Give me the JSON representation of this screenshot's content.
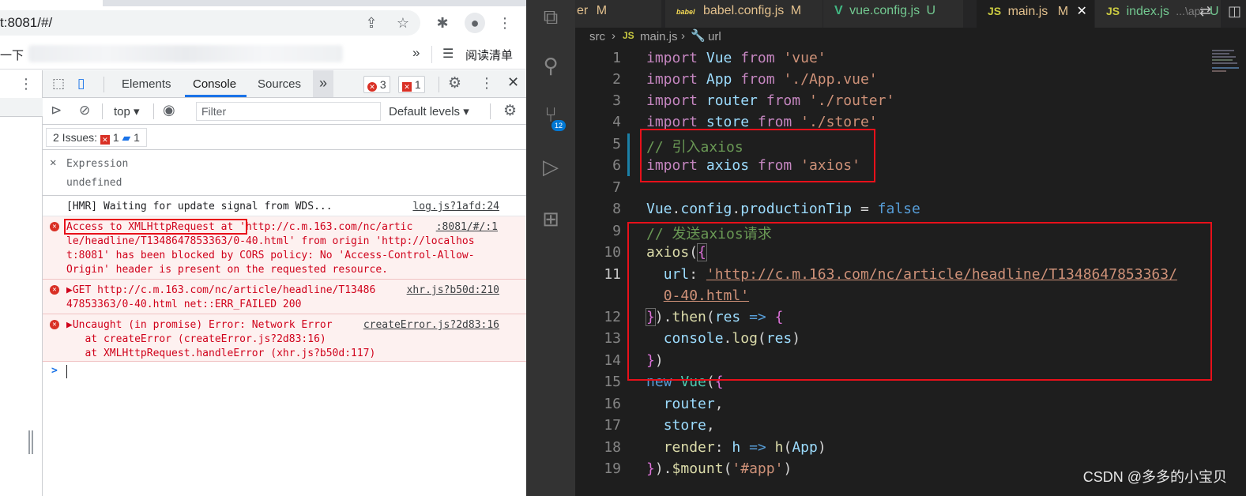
{
  "browser": {
    "address_text": "t:8081/#/",
    "bookmark_left_text": "一下",
    "bookmark_more": "»",
    "reading_list_label": "阅读清单"
  },
  "devtools": {
    "tabs": [
      "Elements",
      "Console",
      "Sources"
    ],
    "more_tabs": "»",
    "error_count": "3",
    "issue_count": "1",
    "context": "top",
    "filter_placeholder": "Filter",
    "levels": "Default levels",
    "issues_label": "2 Issues:",
    "issues_error": "1",
    "issues_info": "1",
    "expression_label": "Expression",
    "expression_value": "undefined",
    "messages": [
      {
        "text": "[HMR] Waiting for update signal from WDS...",
        "source": "log.js?1afd:24"
      },
      {
        "lines": [
          "Access to XMLHttpRequest at 'http://c.m.163.com/nc/artic",
          "le/headline/T1348647853363/0-40.html' from origin 'http://localhos",
          "t:8081' has been blocked by CORS policy: No 'Access-Control-Allow-",
          "Origin' header is present on the requested resource."
        ],
        "source": ":8081/#/:1"
      },
      {
        "lines": [
          "▶GET http://c.m.163.com/nc/article/headline/T13486",
          "47853363/0-40.html net::ERR_FAILED 200"
        ],
        "source": "xhr.js?b50d:210"
      },
      {
        "lines": [
          "▶Uncaught (in promise) Error: Network Error",
          "   at createError (createError.js?2d83:16)",
          "   at XMLHttpRequest.handleError (xhr.js?b50d:117)"
        ],
        "source": "createError.js?2d83:16"
      }
    ],
    "prompt": ">"
  },
  "editor": {
    "tabs": [
      {
        "icon": "",
        "name": "er",
        "status": "M"
      },
      {
        "icon": "babel",
        "name": "babel.config.js",
        "status": "M"
      },
      {
        "icon": "V",
        "name": "vue.config.js",
        "status": "U"
      },
      {
        "icon": "JS",
        "name": "main.js",
        "status": "M",
        "active": true
      },
      {
        "icon": "JS",
        "name": "index.js",
        "path": "...\\api",
        "status": "U"
      }
    ],
    "breadcrumb": [
      "src",
      "main.js",
      "url"
    ],
    "line_numbers": [
      "1",
      "2",
      "3",
      "4",
      "5",
      "6",
      "7",
      "8",
      "9",
      "10",
      "11",
      "",
      "12",
      "13",
      "14",
      "15",
      "16",
      "17",
      "18",
      "19"
    ],
    "source_control_badge": "12",
    "watermark": "CSDN @多多的小宝贝"
  }
}
